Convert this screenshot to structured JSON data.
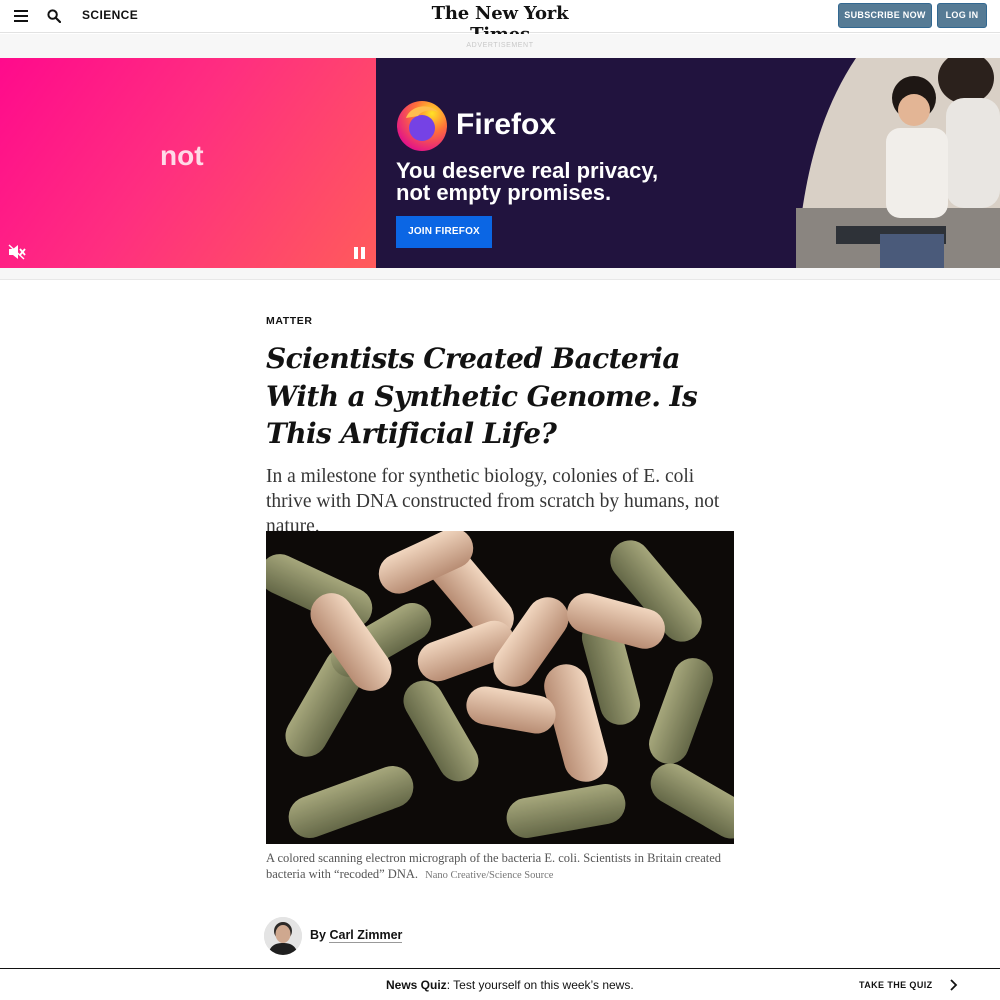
{
  "header": {
    "section": "SCIENCE",
    "logo": "The New York Times",
    "subscribe_label": "SUBSCRIBE NOW",
    "login_label": "LOG IN",
    "icons": {
      "menu": "menu-icon",
      "search": "search-icon"
    }
  },
  "ad": {
    "label": "ADVERTISEMENT",
    "left_word": "not",
    "brand": "Firefox",
    "headline": "You deserve real privacy, not empty promises.",
    "cta": "JOIN FIREFOX",
    "colors": {
      "pink": "#ff0a8c",
      "navy": "#21133e",
      "cta_blue": "#0b66e4",
      "purple": "#7b2fd8"
    },
    "icons": {
      "mute": "mute-icon",
      "pause": "pause-icon",
      "brand_logo": "firefox-logo"
    }
  },
  "article": {
    "kicker": "MATTER",
    "headline": "Scientists Created Bacteria With a Synthetic Genome. Is This Artificial Life?",
    "summary": "In a milestone for synthetic biology, colonies of E. coli thrive with DNA constructed from scratch by humans, not nature.",
    "image_alt": "Colored scanning electron micrograph of E. coli bacteria",
    "caption": "A colored scanning electron micrograph of the bacteria E. coli. Scientists in Britain created bacteria with “recoded” DNA.",
    "credit": "Nano Creative/Science Source",
    "byline_prefix": "By",
    "author": "Carl Zimmer"
  },
  "footer_bar": {
    "quiz_label": "News Quiz",
    "quiz_text": ": Test yourself on this week’s news.",
    "cta": "TAKE THE QUIZ",
    "icons": {
      "next": "chevron-right-icon"
    }
  }
}
